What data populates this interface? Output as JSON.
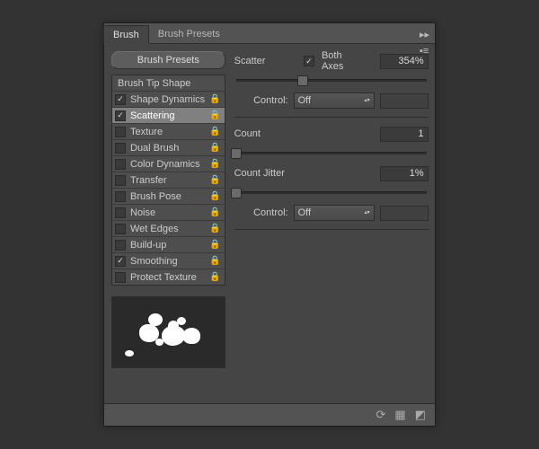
{
  "tabs": {
    "brush": "Brush",
    "presets": "Brush Presets"
  },
  "buttons": {
    "presets": "Brush Presets"
  },
  "options": {
    "header": "Brush Tip Shape",
    "items": [
      {
        "label": "Shape Dynamics",
        "checked": true,
        "sel": false
      },
      {
        "label": "Scattering",
        "checked": true,
        "sel": true
      },
      {
        "label": "Texture",
        "checked": false,
        "sel": false
      },
      {
        "label": "Dual Brush",
        "checked": false,
        "sel": false
      },
      {
        "label": "Color Dynamics",
        "checked": false,
        "sel": false
      },
      {
        "label": "Transfer",
        "checked": false,
        "sel": false
      },
      {
        "label": "Brush Pose",
        "checked": false,
        "sel": false
      },
      {
        "label": "Noise",
        "checked": false,
        "sel": false
      },
      {
        "label": "Wet Edges",
        "checked": false,
        "sel": false
      },
      {
        "label": "Build-up",
        "checked": false,
        "sel": false
      },
      {
        "label": "Smoothing",
        "checked": true,
        "sel": false
      },
      {
        "label": "Protect Texture",
        "checked": false,
        "sel": false
      }
    ]
  },
  "settings": {
    "scatter": {
      "label": "Scatter",
      "bothAxes": "Both Axes",
      "bothAxesChecked": true,
      "value": "354%",
      "slider": 35
    },
    "control1": {
      "label": "Control:",
      "value": "Off"
    },
    "count": {
      "label": "Count",
      "value": "1",
      "slider": 0
    },
    "countJitter": {
      "label": "Count Jitter",
      "value": "1%",
      "slider": 0
    },
    "control2": {
      "label": "Control:",
      "value": "Off"
    }
  }
}
